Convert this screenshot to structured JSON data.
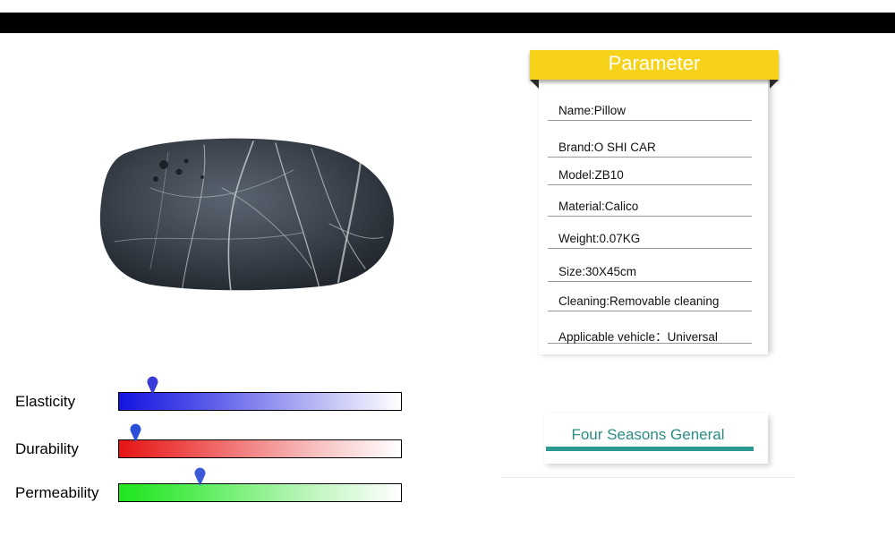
{
  "parameter": {
    "title": "Parameter",
    "items": [
      "Name:Pillow",
      "Brand:O SHI CAR",
      "Model:ZB10",
      "Material:Calico",
      "Weight:0.07KG",
      "Size:30X45cm",
      "Cleaning:Removable cleaning",
      "Applicable vehicle：Universal"
    ],
    "header_color": "#f7d21a"
  },
  "ratings": [
    {
      "label": "Elasticity",
      "level": 0.12,
      "color": "#1a1ae6"
    },
    {
      "label": "Durability",
      "level": 0.06,
      "color": "#e81a1a"
    },
    {
      "label": "Permeability",
      "level": 0.29,
      "color": "#1ae61a"
    }
  ],
  "banner": {
    "text": "Four Seasons General",
    "color": "#2a8c84"
  },
  "product": {
    "image": "stone-pillow"
  }
}
